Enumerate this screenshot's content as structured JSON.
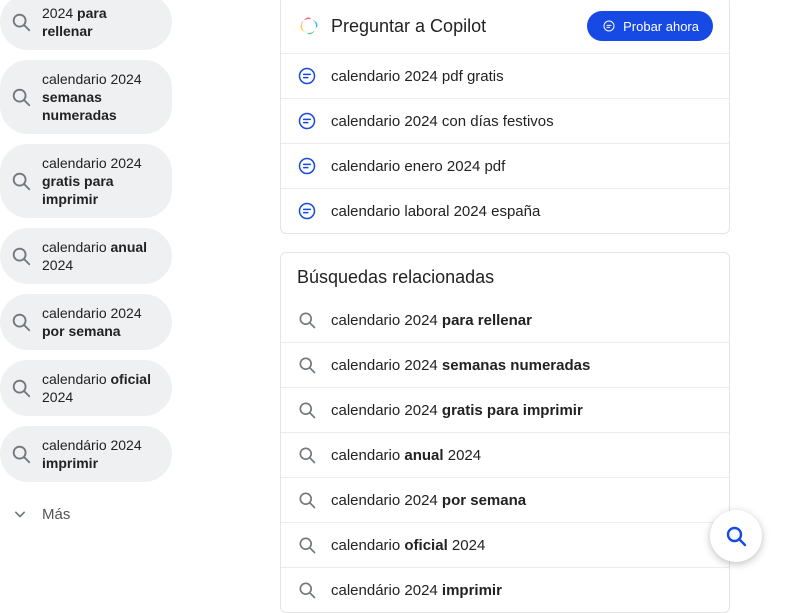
{
  "sidebar": {
    "items": [
      {
        "plain": "2024 ",
        "bold": "para rellenar"
      },
      {
        "plain": "calendario 2024 ",
        "bold": "semanas numeradas"
      },
      {
        "plain": "calendario 2024 ",
        "bold": "gratis para imprimir"
      },
      {
        "plain": "calendario ",
        "bold": "anual",
        "tail": " 2024"
      },
      {
        "plain": "calendario 2024 ",
        "bold": "por semana"
      },
      {
        "plain": "calendario ",
        "bold": "oficial",
        "tail": " 2024"
      },
      {
        "plain": "calendário 2024 ",
        "bold": "imprimir"
      }
    ],
    "more_label": "Más"
  },
  "copilot": {
    "title": "Preguntar a Copilot",
    "try_label": "Probar ahora",
    "suggestions": [
      "calendario 2024 pdf gratis",
      "calendario 2024 con días festivos",
      "calendario enero 2024 pdf",
      "calendario laboral 2024 españa"
    ]
  },
  "related": {
    "title": "Búsquedas relacionadas",
    "items": [
      {
        "plain": "calendario 2024 ",
        "bold": "para rellenar"
      },
      {
        "plain": "calendario 2024 ",
        "bold": "semanas numeradas"
      },
      {
        "plain": "calendario 2024 ",
        "bold": "gratis para imprimir"
      },
      {
        "plain": "calendario ",
        "bold": "anual",
        "tail": " 2024"
      },
      {
        "plain": "calendario 2024 ",
        "bold": "por semana"
      },
      {
        "plain": "calendario ",
        "bold": "oficial",
        "tail": " 2024"
      },
      {
        "plain": "calendário 2024 ",
        "bold": "imprimir"
      }
    ]
  }
}
